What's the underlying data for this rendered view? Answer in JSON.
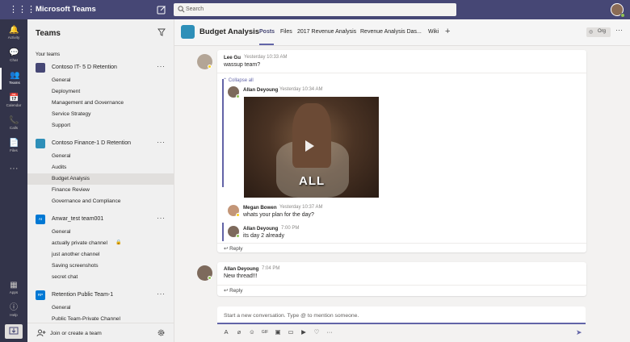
{
  "app": {
    "name": "Microsoft Teams"
  },
  "search": {
    "placeholder": "Search"
  },
  "rail": [
    {
      "label": "Activity",
      "icon": "bell-icon"
    },
    {
      "label": "Chat",
      "icon": "chat-icon"
    },
    {
      "label": "Teams",
      "icon": "teams-icon"
    },
    {
      "label": "Calendar",
      "icon": "calendar-icon"
    },
    {
      "label": "Calls",
      "icon": "phone-icon"
    },
    {
      "label": "Files",
      "icon": "files-icon"
    },
    {
      "label": "Apps",
      "icon": "apps-icon"
    },
    {
      "label": "Help",
      "icon": "help-icon"
    }
  ],
  "leftpane": {
    "title": "Teams",
    "section": "Your teams",
    "teams": [
      {
        "name": "Contoso IT- 5 D Retention",
        "color": "#464775",
        "initials": "",
        "channels": [
          "General",
          "Deployment",
          "Management and Governance",
          "Service Strategy",
          "Support"
        ]
      },
      {
        "name": "Contoso Finance-1 D Retention",
        "color": "#2e8fb8",
        "initials": "",
        "channels": [
          "General",
          "Audits",
          "Budget Analysis",
          "Finance Review",
          "Governance and Compliance"
        ]
      },
      {
        "name": "Anwar_test team001",
        "color": "#0078d4",
        "initials": "AI",
        "channels": [
          "General",
          "actually private channel",
          "just another channel",
          "Saving screenshots",
          "secret chat"
        ]
      },
      {
        "name": "Retention Public Team-1",
        "color": "#0078d4",
        "initials": "RP",
        "channels": [
          "General",
          "Public Team-Private Channel"
        ]
      }
    ],
    "join": "Join or create a team"
  },
  "header": {
    "channel": "Budget Analysis",
    "tabs": [
      "Posts",
      "Files",
      "2017 Revenue Analysis",
      "Revenue Analysis Das...",
      "Wiki"
    ],
    "org": "Org"
  },
  "posts": {
    "lee": {
      "author": "Lee Gu",
      "time": "Yesterday 10:33 AM",
      "text": "wassup team?"
    },
    "collapse": "Collapse all",
    "r1": {
      "author": "Allan Deyoung",
      "time": "Yesterday 10:34 AM",
      "gif_text": "ALL"
    },
    "r2": {
      "author": "Megan Bowen",
      "time": "Yesterday 10:37 AM",
      "text": "whats your plan for the day?"
    },
    "r3": {
      "author": "Allan Deyoung",
      "time": "7:00 PM",
      "text": "its day 2 already"
    },
    "reply1": "Reply",
    "allan2": {
      "author": "Allan Deyoung",
      "time": "7:04 PM",
      "text": "New thread!!!"
    },
    "reply2": "Reply"
  },
  "compose": {
    "placeholder": "Start a new conversation. Type @ to mention someone."
  },
  "colors": {
    "brand": "#464775",
    "accent": "#6264a7",
    "rail": "#33344a",
    "available": "#92c353",
    "away": "#fcd116"
  }
}
